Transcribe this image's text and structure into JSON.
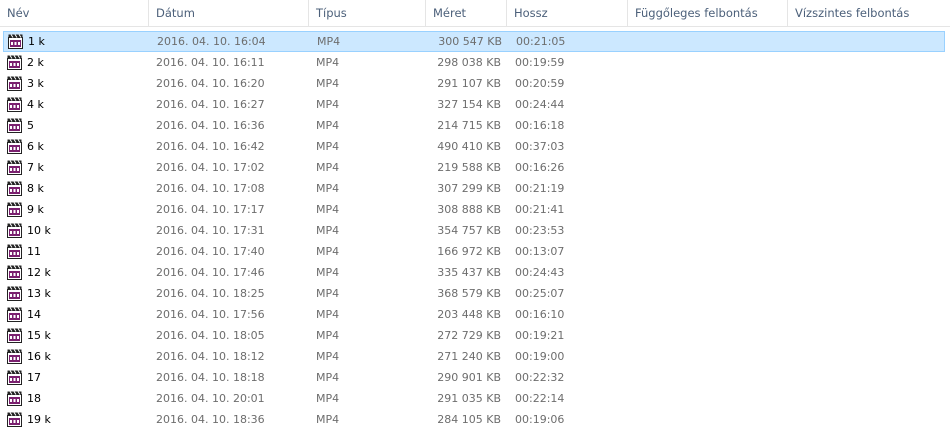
{
  "columns": {
    "name": "Név",
    "date": "Dátum",
    "type": "Típus",
    "size": "Méret",
    "length": "Hossz",
    "vertical_resolution": "Függőleges felbontás",
    "horizontal_resolution": "Vízszintes felbontás"
  },
  "file_icon": "mp4-video-file-icon",
  "colors": {
    "selection_background": "#cce8ff",
    "selection_border": "#99d1ff",
    "header_text": "#4c607a",
    "secondary_text": "#6d6d6d"
  },
  "files": [
    {
      "name": "1 k",
      "date": "2016. 04. 10. 16:04",
      "type": "MP4",
      "size": "300 547 KB",
      "length": "00:21:05",
      "selected": true
    },
    {
      "name": "2 k",
      "date": "2016. 04. 10. 16:11",
      "type": "MP4",
      "size": "298 038 KB",
      "length": "00:19:59"
    },
    {
      "name": "3 k",
      "date": "2016. 04. 10. 16:20",
      "type": "MP4",
      "size": "291 107 KB",
      "length": "00:20:59"
    },
    {
      "name": "4 k",
      "date": "2016. 04. 10. 16:27",
      "type": "MP4",
      "size": "327 154 KB",
      "length": "00:24:44"
    },
    {
      "name": "5",
      "date": "2016. 04. 10. 16:36",
      "type": "MP4",
      "size": "214 715 KB",
      "length": "00:16:18"
    },
    {
      "name": "6 k",
      "date": "2016. 04. 10. 16:42",
      "type": "MP4",
      "size": "490 410 KB",
      "length": "00:37:03"
    },
    {
      "name": "7 k",
      "date": "2016. 04. 10. 17:02",
      "type": "MP4",
      "size": "219 588 KB",
      "length": "00:16:26"
    },
    {
      "name": "8 k",
      "date": "2016. 04. 10. 17:08",
      "type": "MP4",
      "size": "307 299 KB",
      "length": "00:21:19"
    },
    {
      "name": "9 k",
      "date": "2016. 04. 10. 17:17",
      "type": "MP4",
      "size": "308 888 KB",
      "length": "00:21:41"
    },
    {
      "name": "10 k",
      "date": "2016. 04. 10. 17:31",
      "type": "MP4",
      "size": "354 757 KB",
      "length": "00:23:53"
    },
    {
      "name": "11",
      "date": "2016. 04. 10. 17:40",
      "type": "MP4",
      "size": "166 972 KB",
      "length": "00:13:07"
    },
    {
      "name": "12 k",
      "date": "2016. 04. 10. 17:46",
      "type": "MP4",
      "size": "335 437 KB",
      "length": "00:24:43"
    },
    {
      "name": "13 k",
      "date": "2016. 04. 10. 18:25",
      "type": "MP4",
      "size": "368 579 KB",
      "length": "00:25:07"
    },
    {
      "name": "14",
      "date": "2016. 04. 10. 17:56",
      "type": "MP4",
      "size": "203 448 KB",
      "length": "00:16:10"
    },
    {
      "name": "15 k",
      "date": "2016. 04. 10. 18:05",
      "type": "MP4",
      "size": "272 729 KB",
      "length": "00:19:21"
    },
    {
      "name": "16 k",
      "date": "2016. 04. 10. 18:12",
      "type": "MP4",
      "size": "271 240 KB",
      "length": "00:19:00"
    },
    {
      "name": "17",
      "date": "2016. 04. 10. 18:18",
      "type": "MP4",
      "size": "290 901 KB",
      "length": "00:22:32"
    },
    {
      "name": "18",
      "date": "2016. 04. 10. 20:01",
      "type": "MP4",
      "size": "291 035 KB",
      "length": "00:22:14"
    },
    {
      "name": "19 k",
      "date": "2016. 04. 10. 18:36",
      "type": "MP4",
      "size": "284 105 KB",
      "length": "00:19:06"
    }
  ]
}
